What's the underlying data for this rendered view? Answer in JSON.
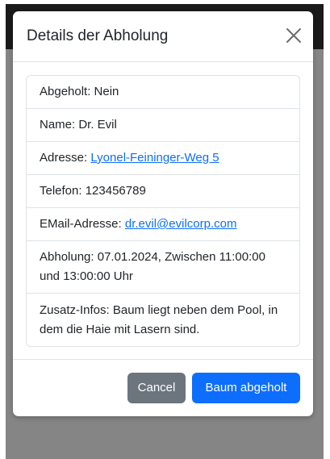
{
  "modal": {
    "title": "Details der Abholung",
    "items": {
      "picked_up": "Abgeholt: Nein",
      "name": "Name: Dr. Evil",
      "address_label": "Adresse: ",
      "address_link": "Lyonel-Feininger-Weg 5",
      "phone": "Telefon: 123456789",
      "email_label": "EMail-Adresse: ",
      "email_link": "dr.evil@evilcorp.com",
      "pickup": "Abholung: 07.01.2024, Zwischen 11:00:00 und 13:00:00 Uhr",
      "extra": "Zusatz-Infos: Baum liegt neben dem Pool, in dem die Haie mit Lasern sind."
    },
    "buttons": {
      "cancel": "Cancel",
      "confirm": "Baum abgeholt"
    }
  },
  "colors": {
    "primary": "#0d6efd",
    "secondary": "#6c757d",
    "backdrop": "#858585"
  },
  "icons": {
    "close": "close-icon"
  }
}
